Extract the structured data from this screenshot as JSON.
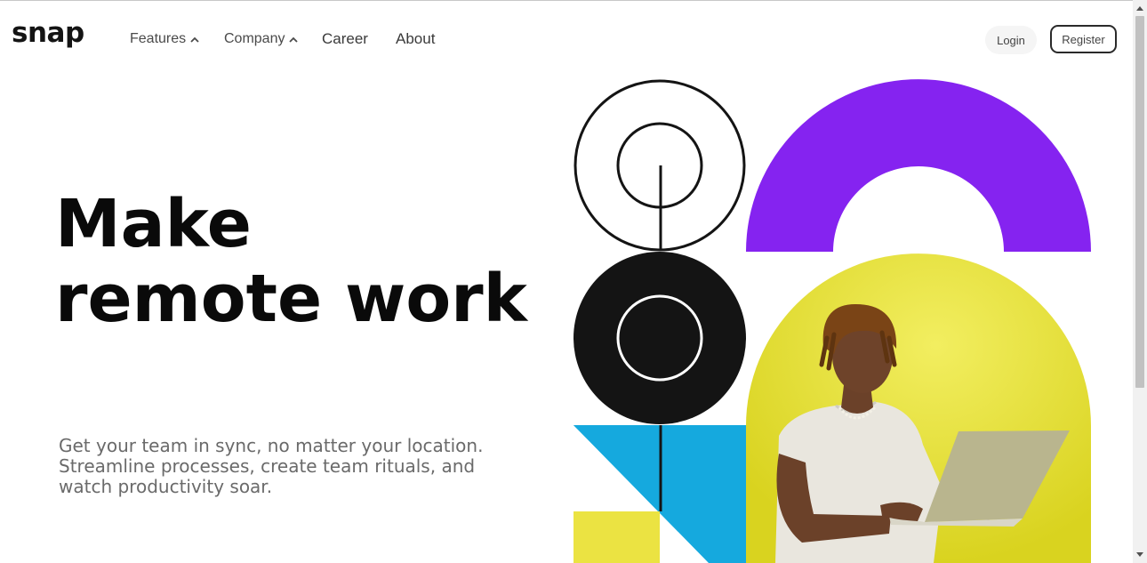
{
  "header": {
    "logo": "snap",
    "nav": [
      {
        "label": "Features",
        "has_dropdown": true
      },
      {
        "label": "Company",
        "has_dropdown": true
      },
      {
        "label": "Career",
        "has_dropdown": false
      },
      {
        "label": "About",
        "has_dropdown": false
      }
    ],
    "login_label": "Login",
    "register_label": "Register"
  },
  "hero": {
    "headline_line1": "Make",
    "headline_line2": "remote work",
    "subtext_line1": "Get your team in sync, no matter your location.",
    "subtext_line2": "Streamline processes, create team rituals, and",
    "subtext_line3": "watch productivity soar."
  },
  "colors": {
    "purple": "#8523F0",
    "yellow": "#EBE342",
    "blue": "#15A9DE",
    "black": "#141414"
  },
  "icons": {
    "dropdown": "chevron-up-icon"
  }
}
